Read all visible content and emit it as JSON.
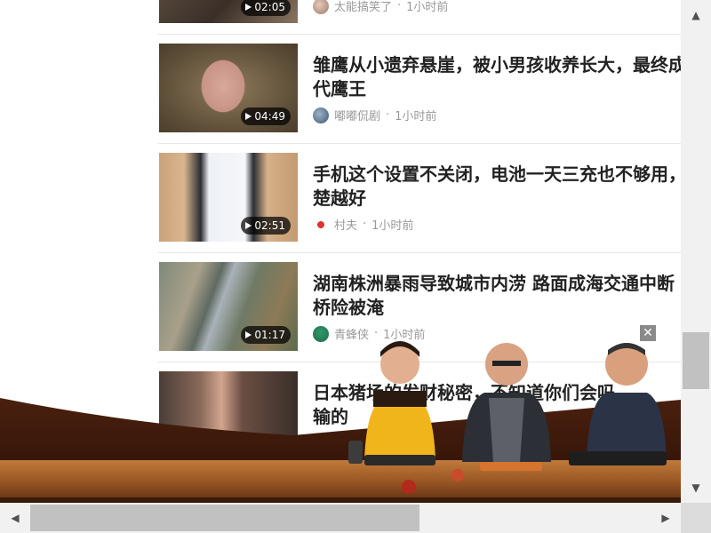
{
  "feed": {
    "items": [
      {
        "title_lines": [
          "",
          ""
        ],
        "duration": "02:05",
        "source": "太能搞笑了",
        "time": "1小时前"
      },
      {
        "title_lines": [
          "雏鹰从小遗弃悬崖，被小男孩收养长大，最终成",
          "代鹰王"
        ],
        "duration": "04:49",
        "source": "嘟嘟侃剧",
        "time": "1小时前"
      },
      {
        "title_lines": [
          "手机这个设置不关闭，电池一天三充也不够用，",
          "楚越好"
        ],
        "duration": "02:51",
        "source": "村夫",
        "time": "1小时前"
      },
      {
        "title_lines": [
          "湖南株洲暴雨导致城市内涝 路面成海交通中断 ",
          "桥险被淹"
        ],
        "duration": "01:17",
        "source": "青蜂侠",
        "time": "1小时前"
      },
      {
        "title_lines": [
          "日本猪场的发财秘密，不知道你们会吗",
          "输的"
        ],
        "duration": "",
        "source": "",
        "time": ""
      }
    ],
    "separator": "·"
  },
  "ad": {
    "close_label": "✕"
  },
  "scrollbars": {
    "up": "▲",
    "down": "▼",
    "left": "◀",
    "right": "▶"
  }
}
